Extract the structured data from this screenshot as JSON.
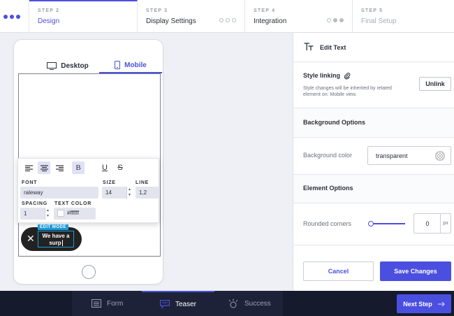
{
  "stepper": {
    "steps": [
      {
        "num": "STEP 2",
        "name": "Design"
      },
      {
        "num": "STEP 3",
        "name": "Display Settings"
      },
      {
        "num": "STEP 4",
        "name": "Integration"
      },
      {
        "num": "STEP 5",
        "name": "Final Setup"
      }
    ]
  },
  "preview": {
    "tabs": [
      {
        "label": "Desktop"
      },
      {
        "label": "Mobile"
      }
    ],
    "toolbar": {
      "bold_glyph": "B",
      "underline_glyph": "U",
      "strike_glyph": "S",
      "font_label": "FONT",
      "font_value": "raleway",
      "size_label": "SIZE",
      "size_value": "14",
      "line_label": "LINE",
      "line_value": "1,2",
      "spacing_label": "SPACING",
      "spacing_value": "1",
      "color_label": "TEXT COLOR",
      "color_value": "#ffffff"
    },
    "teaser": {
      "close_glyph": "✕",
      "edit_badge": "EDIT MODE",
      "text_line1": "We have a",
      "text_line2": "surp"
    }
  },
  "panel": {
    "title": "Edit Text",
    "style_linking": {
      "title": "Style linking",
      "desc": "Style changes will be inherited by related element on: Mobile view.",
      "unlink_label": "Unlink"
    },
    "background_options": {
      "title": "Background Options",
      "color_label": "Background color",
      "color_value": "transparent"
    },
    "element_options": {
      "title": "Element Options",
      "rounded_label": "Rounded corners",
      "rounded_value": "0",
      "rounded_unit": "px"
    },
    "cancel_label": "Cancel",
    "save_label": "Save Changes"
  },
  "bottombar": {
    "items": [
      {
        "label": "Form"
      },
      {
        "label": "Teaser"
      },
      {
        "label": "Success"
      }
    ],
    "next_label": "Next Step"
  },
  "colors": {
    "accent": "#4b4fe0",
    "edit_mode": "#1e9bd7",
    "bottombar": "#151a2d"
  }
}
